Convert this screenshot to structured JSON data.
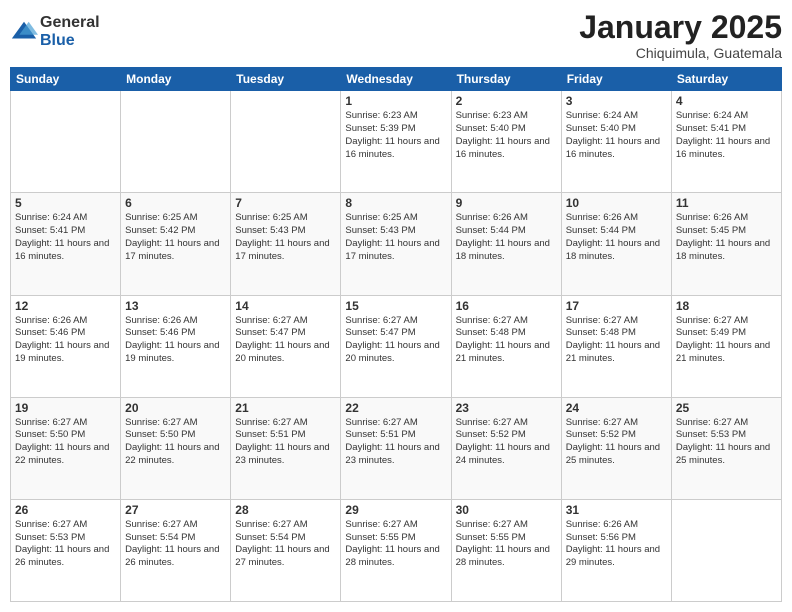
{
  "logo": {
    "general": "General",
    "blue": "Blue"
  },
  "header": {
    "month": "January 2025",
    "location": "Chiquimula, Guatemala"
  },
  "weekdays": [
    "Sunday",
    "Monday",
    "Tuesday",
    "Wednesday",
    "Thursday",
    "Friday",
    "Saturday"
  ],
  "weeks": [
    [
      {
        "day": "",
        "info": ""
      },
      {
        "day": "",
        "info": ""
      },
      {
        "day": "",
        "info": ""
      },
      {
        "day": "1",
        "info": "Sunrise: 6:23 AM\nSunset: 5:39 PM\nDaylight: 11 hours\nand 16 minutes."
      },
      {
        "day": "2",
        "info": "Sunrise: 6:23 AM\nSunset: 5:40 PM\nDaylight: 11 hours\nand 16 minutes."
      },
      {
        "day": "3",
        "info": "Sunrise: 6:24 AM\nSunset: 5:40 PM\nDaylight: 11 hours\nand 16 minutes."
      },
      {
        "day": "4",
        "info": "Sunrise: 6:24 AM\nSunset: 5:41 PM\nDaylight: 11 hours\nand 16 minutes."
      }
    ],
    [
      {
        "day": "5",
        "info": "Sunrise: 6:24 AM\nSunset: 5:41 PM\nDaylight: 11 hours\nand 16 minutes."
      },
      {
        "day": "6",
        "info": "Sunrise: 6:25 AM\nSunset: 5:42 PM\nDaylight: 11 hours\nand 17 minutes."
      },
      {
        "day": "7",
        "info": "Sunrise: 6:25 AM\nSunset: 5:43 PM\nDaylight: 11 hours\nand 17 minutes."
      },
      {
        "day": "8",
        "info": "Sunrise: 6:25 AM\nSunset: 5:43 PM\nDaylight: 11 hours\nand 17 minutes."
      },
      {
        "day": "9",
        "info": "Sunrise: 6:26 AM\nSunset: 5:44 PM\nDaylight: 11 hours\nand 18 minutes."
      },
      {
        "day": "10",
        "info": "Sunrise: 6:26 AM\nSunset: 5:44 PM\nDaylight: 11 hours\nand 18 minutes."
      },
      {
        "day": "11",
        "info": "Sunrise: 6:26 AM\nSunset: 5:45 PM\nDaylight: 11 hours\nand 18 minutes."
      }
    ],
    [
      {
        "day": "12",
        "info": "Sunrise: 6:26 AM\nSunset: 5:46 PM\nDaylight: 11 hours\nand 19 minutes."
      },
      {
        "day": "13",
        "info": "Sunrise: 6:26 AM\nSunset: 5:46 PM\nDaylight: 11 hours\nand 19 minutes."
      },
      {
        "day": "14",
        "info": "Sunrise: 6:27 AM\nSunset: 5:47 PM\nDaylight: 11 hours\nand 20 minutes."
      },
      {
        "day": "15",
        "info": "Sunrise: 6:27 AM\nSunset: 5:47 PM\nDaylight: 11 hours\nand 20 minutes."
      },
      {
        "day": "16",
        "info": "Sunrise: 6:27 AM\nSunset: 5:48 PM\nDaylight: 11 hours\nand 21 minutes."
      },
      {
        "day": "17",
        "info": "Sunrise: 6:27 AM\nSunset: 5:48 PM\nDaylight: 11 hours\nand 21 minutes."
      },
      {
        "day": "18",
        "info": "Sunrise: 6:27 AM\nSunset: 5:49 PM\nDaylight: 11 hours\nand 21 minutes."
      }
    ],
    [
      {
        "day": "19",
        "info": "Sunrise: 6:27 AM\nSunset: 5:50 PM\nDaylight: 11 hours\nand 22 minutes."
      },
      {
        "day": "20",
        "info": "Sunrise: 6:27 AM\nSunset: 5:50 PM\nDaylight: 11 hours\nand 22 minutes."
      },
      {
        "day": "21",
        "info": "Sunrise: 6:27 AM\nSunset: 5:51 PM\nDaylight: 11 hours\nand 23 minutes."
      },
      {
        "day": "22",
        "info": "Sunrise: 6:27 AM\nSunset: 5:51 PM\nDaylight: 11 hours\nand 23 minutes."
      },
      {
        "day": "23",
        "info": "Sunrise: 6:27 AM\nSunset: 5:52 PM\nDaylight: 11 hours\nand 24 minutes."
      },
      {
        "day": "24",
        "info": "Sunrise: 6:27 AM\nSunset: 5:52 PM\nDaylight: 11 hours\nand 25 minutes."
      },
      {
        "day": "25",
        "info": "Sunrise: 6:27 AM\nSunset: 5:53 PM\nDaylight: 11 hours\nand 25 minutes."
      }
    ],
    [
      {
        "day": "26",
        "info": "Sunrise: 6:27 AM\nSunset: 5:53 PM\nDaylight: 11 hours\nand 26 minutes."
      },
      {
        "day": "27",
        "info": "Sunrise: 6:27 AM\nSunset: 5:54 PM\nDaylight: 11 hours\nand 26 minutes."
      },
      {
        "day": "28",
        "info": "Sunrise: 6:27 AM\nSunset: 5:54 PM\nDaylight: 11 hours\nand 27 minutes."
      },
      {
        "day": "29",
        "info": "Sunrise: 6:27 AM\nSunset: 5:55 PM\nDaylight: 11 hours\nand 28 minutes."
      },
      {
        "day": "30",
        "info": "Sunrise: 6:27 AM\nSunset: 5:55 PM\nDaylight: 11 hours\nand 28 minutes."
      },
      {
        "day": "31",
        "info": "Sunrise: 6:26 AM\nSunset: 5:56 PM\nDaylight: 11 hours\nand 29 minutes."
      },
      {
        "day": "",
        "info": ""
      }
    ]
  ]
}
